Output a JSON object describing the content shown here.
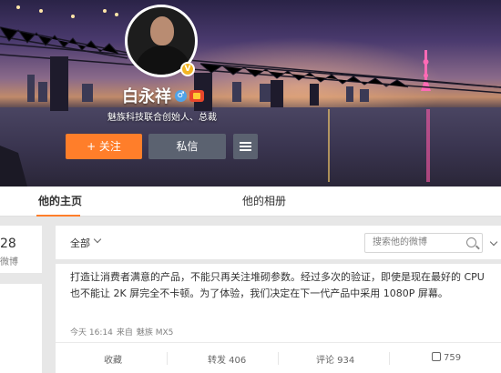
{
  "profile": {
    "name": "白永祥",
    "subtitle": "魅族科技联合创始人、总裁",
    "verified_badge": "V",
    "gender_symbol": "♂"
  },
  "buttons": {
    "follow": "+ 关注",
    "message": "私信"
  },
  "tabs": [
    {
      "label": "他的主页",
      "active": true
    },
    {
      "label": "他的相册",
      "active": false
    }
  ],
  "stats": {
    "number": "28",
    "label": "微博"
  },
  "filter": {
    "selected": "全部",
    "search_placeholder": "搜索他的微博"
  },
  "post": {
    "text": "打造让消费者满意的产品，不能只再关注堆砌参数。经过多次的验证，即使是现在最好的 CPU 也不能让 2K 屏完全不卡顿。为了体验，我们决定在下一代产品中采用 1080P 屏幕。",
    "time": "今天 16:14",
    "source_prefix": "来自",
    "source": "魅族 MX5",
    "actions": {
      "favorite": "收藏",
      "forward": "转发 406",
      "comment": "评论 934",
      "like": "759"
    }
  },
  "colors": {
    "accent": "#ff7e2a",
    "button_dark": "#5b6270",
    "verified": "#f3b623"
  }
}
